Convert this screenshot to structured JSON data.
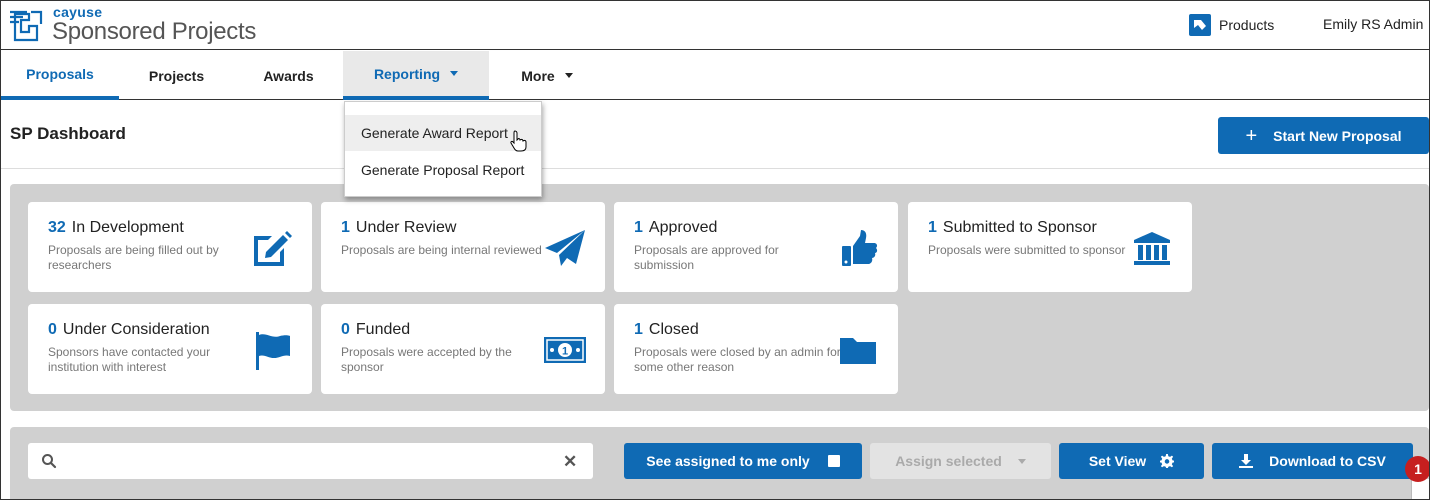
{
  "header": {
    "brand_small": "cayuse",
    "brand_large": "Sponsored Projects",
    "products_label": "Products",
    "user_name": "Emily RS Admin"
  },
  "nav": {
    "tabs": [
      {
        "label": "Proposals",
        "state": "active"
      },
      {
        "label": "Projects",
        "state": "normal"
      },
      {
        "label": "Awards",
        "state": "normal"
      },
      {
        "label": "Reporting",
        "state": "open"
      },
      {
        "label": "More",
        "state": "normal"
      }
    ]
  },
  "reporting_menu": {
    "items": [
      "Generate Award Report",
      "Generate Proposal Report"
    ]
  },
  "page": {
    "title": "SP Dashboard",
    "start_button": "Start New Proposal"
  },
  "cards": [
    {
      "count": "32",
      "title": "In Development",
      "description": "Proposals are being filled out by researchers",
      "icon": "edit-icon"
    },
    {
      "count": "1",
      "title": "Under Review",
      "description": "Proposals are being internal reviewed",
      "icon": "paper-plane-icon"
    },
    {
      "count": "1",
      "title": "Approved",
      "description": "Proposals are approved for submission",
      "icon": "thumbs-up-icon"
    },
    {
      "count": "1",
      "title": "Submitted to Sponsor",
      "description": "Proposals were submitted to sponsor",
      "icon": "institution-icon"
    },
    {
      "count": "0",
      "title": "Under Consideration",
      "description": "Sponsors have contacted your institution with interest",
      "icon": "flag-icon"
    },
    {
      "count": "0",
      "title": "Funded",
      "description": "Proposals were accepted by the sponsor",
      "icon": "money-icon"
    },
    {
      "count": "1",
      "title": "Closed",
      "description": "Proposals were closed by an admin for some other reason",
      "icon": "folder-icon"
    }
  ],
  "toolbar": {
    "search_value": "",
    "search_placeholder": "",
    "assigned_label": "See assigned to me only",
    "assign_selected_label": "Assign selected",
    "set_view_label": "Set View",
    "download_label": "Download to CSV"
  },
  "notification_count": "1",
  "colors": {
    "accent": "#0f6ab4",
    "panel": "#d0d0d0",
    "badge": "#c61f1f"
  }
}
